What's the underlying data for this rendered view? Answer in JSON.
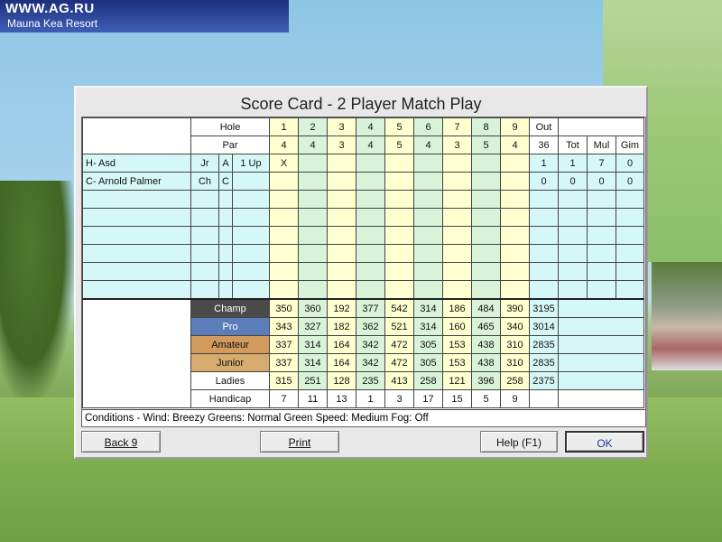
{
  "banner": {
    "site": "WWW.AG.RU",
    "resort": "Mauna Kea Resort"
  },
  "dialog": {
    "title": "Score Card - 2 Player Match Play",
    "conditions": "Conditions - Wind: Breezy  Greens: Normal  Green Speed: Medium  Fog: Off"
  },
  "header": {
    "hole_label": "Hole",
    "par_label": "Par",
    "holes": [
      "1",
      "2",
      "3",
      "4",
      "5",
      "6",
      "7",
      "8",
      "9"
    ],
    "out_label": "Out",
    "pars": [
      "4",
      "4",
      "3",
      "4",
      "5",
      "4",
      "3",
      "5",
      "4"
    ],
    "par_out": "36",
    "tot_label": "Tot",
    "mul_label": "Mul",
    "gim_label": "Gim"
  },
  "players": [
    {
      "name": "H- Asd",
      "c1": "Jr",
      "c2": "A",
      "c3": "1 Up",
      "scores": [
        "X",
        "",
        "",
        "",
        "",
        "",
        "",
        "",
        ""
      ],
      "out": "1",
      "tot": "1",
      "mul": "7",
      "gim": "0"
    },
    {
      "name": "C- Arnold Palmer",
      "c1": "Ch",
      "c2": "C",
      "c3": "",
      "scores": [
        "",
        "",
        "",
        "",
        "",
        "",
        "",
        "",
        ""
      ],
      "out": "0",
      "tot": "0",
      "mul": "0",
      "gim": "0"
    }
  ],
  "tees": [
    {
      "label": "Champ",
      "values": [
        "350",
        "360",
        "192",
        "377",
        "542",
        "314",
        "186",
        "484",
        "390"
      ],
      "out": "3195"
    },
    {
      "label": "Pro",
      "values": [
        "343",
        "327",
        "182",
        "362",
        "521",
        "314",
        "160",
        "465",
        "340"
      ],
      "out": "3014"
    },
    {
      "label": "Amateur",
      "values": [
        "337",
        "314",
        "164",
        "342",
        "472",
        "305",
        "153",
        "438",
        "310"
      ],
      "out": "2835"
    },
    {
      "label": "Junior",
      "values": [
        "337",
        "314",
        "164",
        "342",
        "472",
        "305",
        "153",
        "438",
        "310"
      ],
      "out": "2835"
    },
    {
      "label": "Ladies",
      "values": [
        "315",
        "251",
        "128",
        "235",
        "413",
        "258",
        "121",
        "396",
        "258"
      ],
      "out": "2375"
    },
    {
      "label": "Handicap",
      "values": [
        "7",
        "11",
        "13",
        "1",
        "3",
        "17",
        "15",
        "5",
        "9"
      ],
      "out": ""
    }
  ],
  "buttons": {
    "back": "Back 9",
    "print": "Print",
    "help": "Help (F1)",
    "ok": "OK"
  },
  "colors": {
    "champ": "#4a4a4a",
    "pro": "#5b7dba",
    "amateur": "#d29a5c",
    "junior": "#d6ab6e",
    "odd_hole": "#ffffd0",
    "even_hole": "#d8f3d8",
    "player_row": "#d6f7f7"
  },
  "icons": {
    "tee": "golf-tee-icon"
  }
}
